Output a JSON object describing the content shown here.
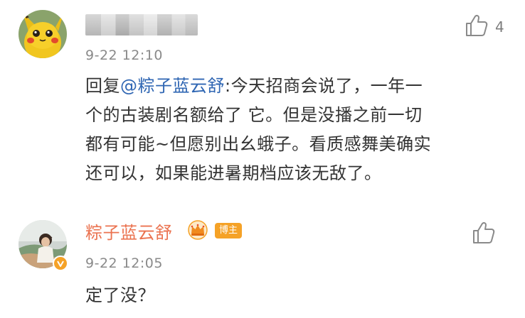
{
  "comments": [
    {
      "username_blurred": true,
      "timestamp": "9-22 12:10",
      "like_count": "4",
      "reply_prefix": "回复",
      "mention": "@粽子蓝云舒",
      "lines": [
        ":今天招商会说了，一年一",
        "个的古装剧名额给了 它。但是没播之前一切",
        "都有可能~但愿别出幺蛾子。看质感舞美确实",
        "还可以，如果能进暑期档应该无敌了。"
      ],
      "avatar_icon": "pikachu-avatar-icon"
    },
    {
      "username": "粽子蓝云舒",
      "badge": "博主",
      "timestamp": "9-22 12:05",
      "text": "定了没？",
      "avatar_icon": "user-photo-avatar-icon"
    }
  ],
  "colors": {
    "username": "#eb7350",
    "mention": "#2f66b3",
    "timestamp": "#8a8a8a",
    "body_text": "#333333",
    "badge": "#f5a227"
  },
  "icons": [
    "like-thumb-icon",
    "crown-icon",
    "verified-v-icon"
  ]
}
